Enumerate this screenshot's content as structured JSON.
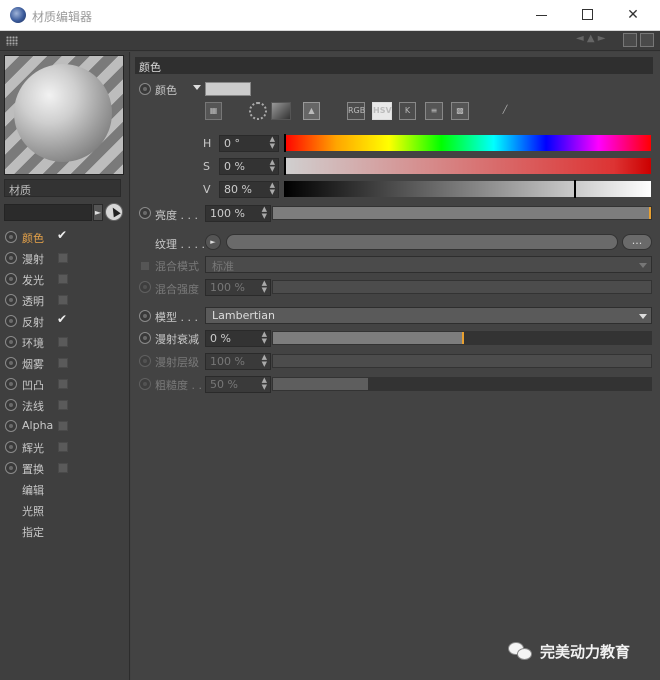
{
  "window": {
    "title": "材质编辑器",
    "controls": {
      "minimize": "minimize",
      "maximize": "maximize",
      "close": "✕"
    }
  },
  "left": {
    "material_name": "材质",
    "channels": [
      {
        "label": "颜色",
        "checked": true,
        "active": true
      },
      {
        "label": "漫射",
        "checked": false,
        "active": false
      },
      {
        "label": "发光",
        "checked": false,
        "active": false
      },
      {
        "label": "透明",
        "checked": false,
        "active": false
      },
      {
        "label": "反射",
        "checked": true,
        "active": false
      },
      {
        "label": "环境",
        "checked": false,
        "active": false
      },
      {
        "label": "烟雾",
        "checked": false,
        "active": false
      },
      {
        "label": "凹凸",
        "checked": false,
        "active": false
      },
      {
        "label": "法线",
        "checked": false,
        "active": false
      },
      {
        "label": "Alpha",
        "checked": false,
        "active": false
      },
      {
        "label": "辉光",
        "checked": false,
        "active": false
      },
      {
        "label": "置换",
        "checked": false,
        "active": false
      }
    ],
    "extra_items": [
      "编辑",
      "光照",
      "指定"
    ],
    "check_mark": "✔"
  },
  "color_section": {
    "header": "颜色",
    "color_label": "颜色",
    "swatch_color": "#cccccc",
    "mode_icons": {
      "rgb": "RGB",
      "hsv": "HSV",
      "k": "K"
    },
    "h": {
      "label": "H",
      "value": "0 °",
      "fraction": 0.0
    },
    "s": {
      "label": "S",
      "value": "0 %",
      "fraction": 0.0
    },
    "v": {
      "label": "V",
      "value": "80 %",
      "fraction": 0.8
    },
    "brightness": {
      "label": "亮度 . . .",
      "value": "100 %",
      "fraction": 1.0
    },
    "texture": {
      "label": "纹理 . . . .",
      "more": "..."
    },
    "blend_mode": {
      "label": "混合模式",
      "value": "标准"
    },
    "blend_strength": {
      "label": "混合强度",
      "value": "100 %",
      "fraction": 1.0
    },
    "model": {
      "label": "模型 . . .",
      "value": "Lambertian"
    },
    "diffuse_falloff": {
      "label": "漫射衰减",
      "value": "0 %",
      "fraction": 0.5
    },
    "diffuse_level": {
      "label": "漫射层级",
      "value": "100 %",
      "fraction": 1.0
    },
    "roughness": {
      "label": "粗糙度 . .",
      "value": "50 %",
      "fraction": 0.5
    }
  },
  "watermark": {
    "text": "完美动力教育"
  }
}
